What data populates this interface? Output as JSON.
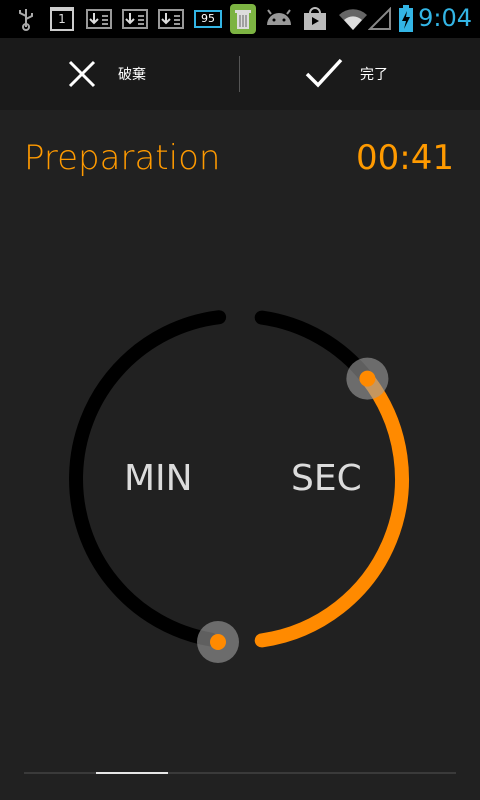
{
  "status_bar": {
    "time": "9:04",
    "calendar_day": "1",
    "battery_text": "95",
    "icons": [
      "usb-icon",
      "calendar-icon",
      "download-icon",
      "download-icon",
      "download-icon",
      "battery-level-icon",
      "trash-icon",
      "android-icon",
      "play-store-icon",
      "wifi-icon",
      "cell-signal-icon",
      "battery-charging-icon"
    ],
    "accent_color": "#33b5e5"
  },
  "action_bar": {
    "discard_label": "破棄",
    "done_label": "完了"
  },
  "header": {
    "title": "Preparation",
    "time": "00:41",
    "accent_color": "#ff9a00"
  },
  "dial": {
    "min_label": "MIN",
    "sec_label": "SEC",
    "progress_fraction": 0.34,
    "progress_color": "#ff8a00"
  },
  "pager": {
    "page": 2,
    "pages": 6
  }
}
